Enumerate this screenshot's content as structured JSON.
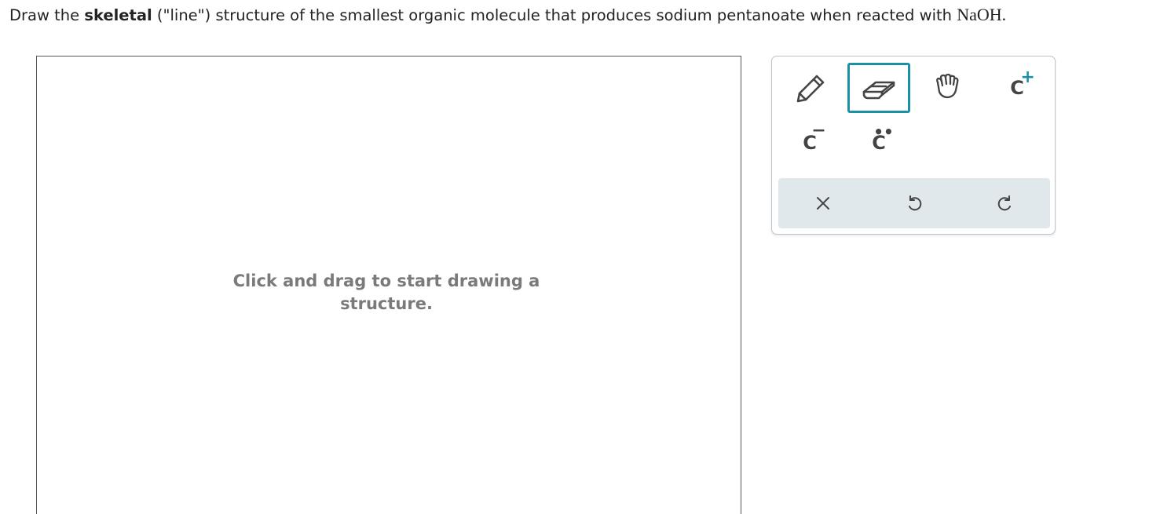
{
  "question": {
    "prefix": "Draw the ",
    "bold": "skeletal",
    "middle": " (\"line\") structure of the smallest organic molecule that produces sodium pentanoate when reacted with ",
    "reagent": "NaOH",
    "suffix": "."
  },
  "canvas": {
    "hint": "Click and drag to start drawing a structure."
  },
  "toolbar": {
    "tools": [
      {
        "name": "pencil-tool",
        "icon": "pencil-icon"
      },
      {
        "name": "eraser-tool",
        "icon": "eraser-icon",
        "selected": true
      },
      {
        "name": "hand-tool",
        "icon": "hand-icon"
      },
      {
        "name": "carbocation-tool",
        "atom": "C",
        "charge": "+"
      },
      {
        "name": "carbanion-tool",
        "atom": "C",
        "charge": "−"
      },
      {
        "name": "lone-pair-tool",
        "atom": "C",
        "dots": "••"
      }
    ],
    "actions": [
      {
        "name": "clear-button",
        "icon": "close-icon"
      },
      {
        "name": "undo-button",
        "icon": "undo-icon"
      },
      {
        "name": "redo-button",
        "icon": "redo-icon"
      }
    ],
    "accent_color": "#1a91a9"
  }
}
